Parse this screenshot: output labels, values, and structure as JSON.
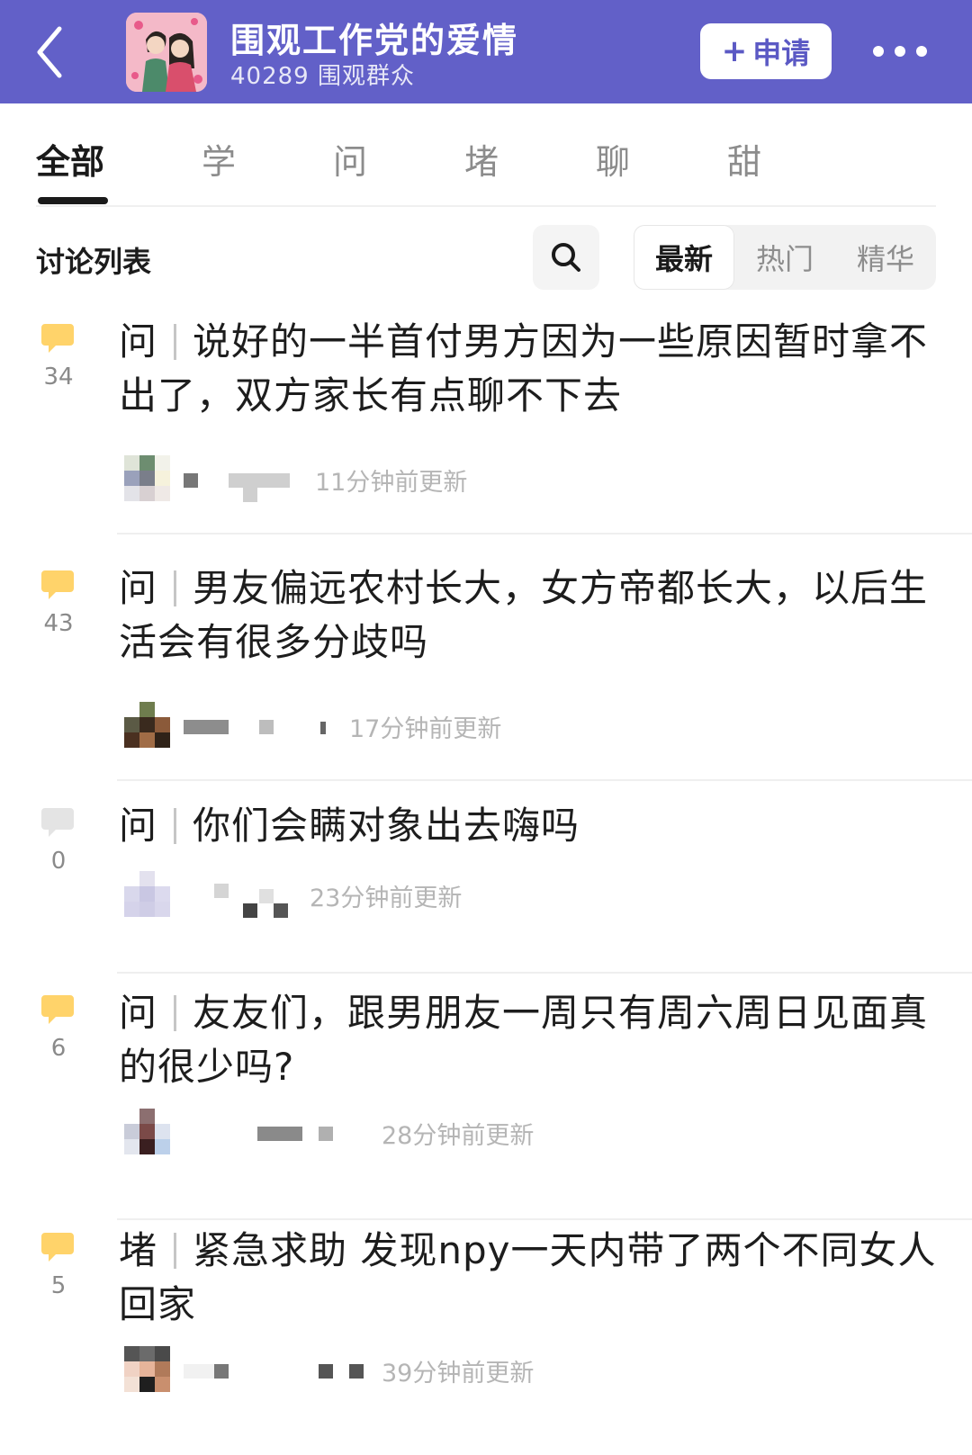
{
  "header": {
    "title": "围观工作党的爱情",
    "subtitle": "40289 围观群众",
    "apply_label": "申请",
    "apply_icon": "plus-icon",
    "back_icon": "chevron-left-icon",
    "more_icon": "more-dots-icon",
    "background_color": "#6260c8"
  },
  "tabs": [
    "全部",
    "学",
    "问",
    "堵",
    "聊",
    "甜"
  ],
  "list": {
    "title": "讨论列表",
    "search_icon": "search-icon",
    "sort_options": [
      "最新",
      "热门",
      "精华"
    ],
    "sort_selected": "最新"
  },
  "posts": [
    {
      "category": "问",
      "title": "说好的一半首付男方因为一些原因暂时拿不出了，双方家长有点聊不下去",
      "count": "34",
      "time": "11分钟前更新"
    },
    {
      "category": "问",
      "title": "男友偏远农村长大，女方帝都长大，以后生活会有很多分歧吗",
      "count": "43",
      "time": "17分钟前更新"
    },
    {
      "category": "问",
      "title": "你们会瞒对象出去嗨吗",
      "count": "0",
      "time": "23分钟前更新"
    },
    {
      "category": "问",
      "title": "友友们，跟男朋友一周只有周六周日见面真的很少吗?",
      "count": "6",
      "time": "28分钟前更新"
    },
    {
      "category": "堵",
      "title": "紧急求助 发现npy一天内带了两个不同女人回家",
      "count": "5",
      "time": "39分钟前更新"
    }
  ]
}
